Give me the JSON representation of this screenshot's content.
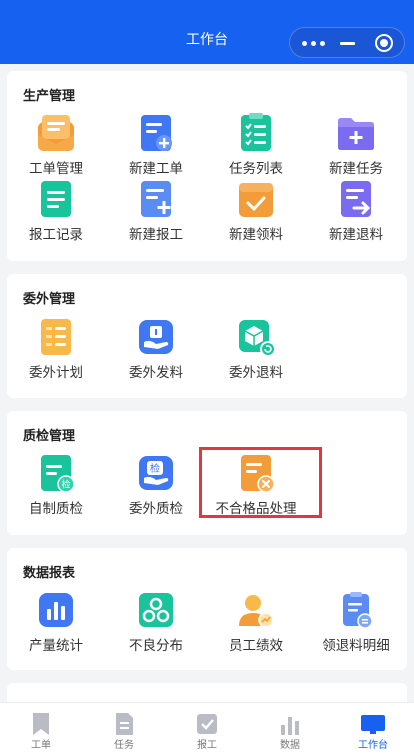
{
  "header": {
    "title": "工作台"
  },
  "sections": {
    "production": {
      "title": "生产管理",
      "items": [
        "工单管理",
        "新建工单",
        "任务列表",
        "新建任务",
        "报工记录",
        "新建报工",
        "新建领料",
        "新建退料"
      ]
    },
    "outsource": {
      "title": "委外管理",
      "items": [
        "委外计划",
        "委外发料",
        "委外退料"
      ]
    },
    "quality": {
      "title": "质检管理",
      "items": [
        "自制质检",
        "委外质检",
        "不合格品处理"
      ],
      "icon_badges": [
        "检",
        "检"
      ]
    },
    "reports": {
      "title": "数据报表",
      "items": [
        "产量统计",
        "不良分布",
        "员工绩效",
        "领退料明细"
      ]
    }
  },
  "tabbar": {
    "items": [
      "工单",
      "任务",
      "报工",
      "数据",
      "工作台"
    ],
    "active": "工作台"
  },
  "colors": {
    "primary": "#1761f0",
    "orange": "#f39c3a",
    "green": "#19c39b",
    "purple": "#7a6bf0",
    "highlight": "#e0383e"
  }
}
